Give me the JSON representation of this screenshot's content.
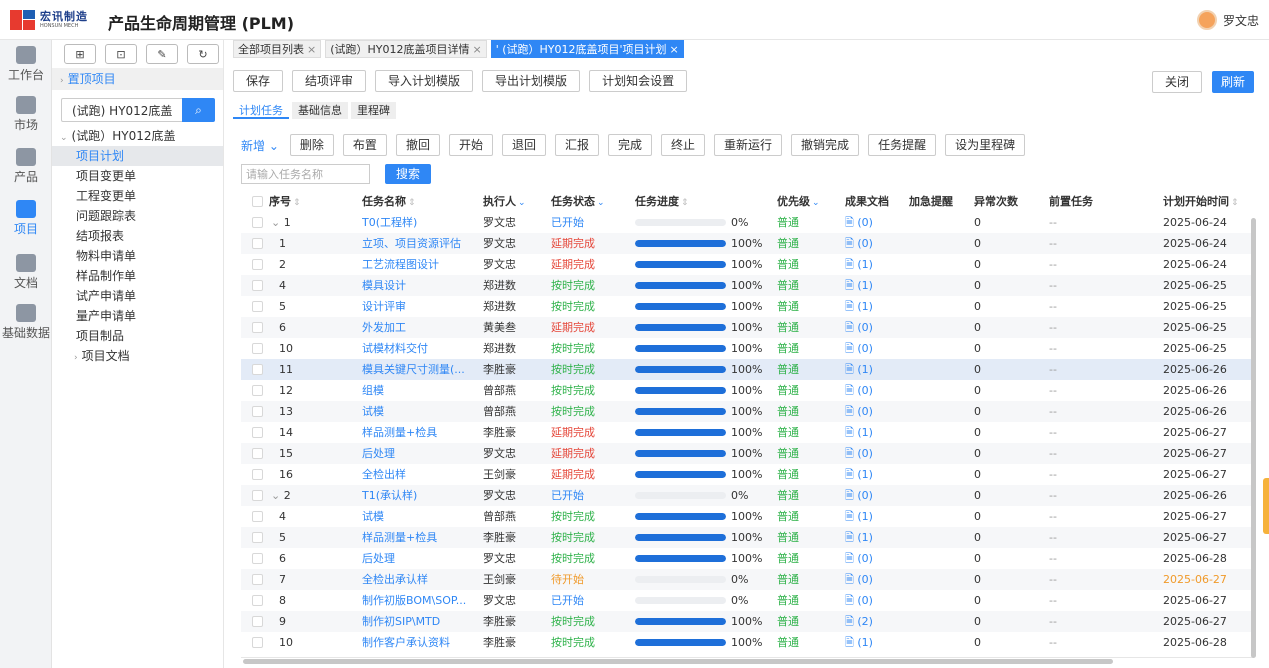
{
  "brand": {
    "name_cn": "宏讯制造",
    "name_en": "HONSUN MECH"
  },
  "app_title": "产品生命周期管理 (PLM)",
  "user": {
    "name": "罗文忠"
  },
  "rail": [
    {
      "label": "工作台",
      "active": false
    },
    {
      "label": "市场",
      "active": false
    },
    {
      "label": "产品",
      "active": false
    },
    {
      "label": "项目",
      "active": true
    },
    {
      "label": "文档",
      "active": false
    },
    {
      "label": "基础数据",
      "active": false
    }
  ],
  "tree": {
    "tools": [
      "⊞",
      "⊡",
      "✎",
      "↻"
    ],
    "pinned": "置顶项目",
    "search_value": "(试跑) HY012底盖",
    "search_icon": "search-icon",
    "root": "(试跑）HY012底盖",
    "children": [
      "项目计划",
      "项目变更单",
      "工程变更单",
      "问题跟踪表",
      "结项报表",
      "物料申请单",
      "样品制作单",
      "试产申请单",
      "量产申请单",
      "项目制品"
    ],
    "selected_index": 0,
    "folder": "项目文档"
  },
  "tabs": [
    {
      "label": "全部项目列表",
      "active": false
    },
    {
      "label": "(试跑）HY012底盖项目详情",
      "active": false
    },
    {
      "label": "' (试跑）HY012底盖项目'项目计划",
      "active": true
    }
  ],
  "toolbar1": [
    "保存",
    "结项评审",
    "导入计划模版",
    "导出计划模版",
    "计划知会设置"
  ],
  "toolbar1_right": {
    "close": "关闭",
    "refresh": "刷新"
  },
  "subtabs": [
    {
      "label": "计划任务",
      "active": true
    },
    {
      "label": "基础信息",
      "active": false
    },
    {
      "label": "里程碑",
      "active": false
    }
  ],
  "toolbar2": {
    "new": "新增",
    "buttons": [
      "删除",
      "布置",
      "撤回",
      "开始",
      "退回",
      "汇报",
      "完成",
      "终止",
      "重新运行",
      "撤销完成",
      "任务提醒",
      "设为里程碑"
    ]
  },
  "filter": {
    "placeholder": "请输入任务名称",
    "search": "搜索"
  },
  "columns": [
    "序号",
    "任务名称",
    "执行人",
    "任务状态",
    "任务进度",
    "优先级",
    "成果文档",
    "加急提醒",
    "异常次数",
    "前置任务",
    "计划开始时间"
  ],
  "rows": [
    {
      "no": "1",
      "group": true,
      "name": "T0(工程样)",
      "owner": "罗文忠",
      "status": "已开始",
      "status_type": "blue",
      "progress": 0,
      "prio": "普通",
      "docs": "(0)",
      "abn": "0",
      "pre": "--",
      "date": "2025-06-24"
    },
    {
      "no": "1",
      "name": "立项、项目资源评估",
      "owner": "罗文忠",
      "status": "延期完成",
      "status_type": "red",
      "progress": 100,
      "prio": "普通",
      "docs": "(0)",
      "abn": "0",
      "pre": "--",
      "date": "2025-06-24"
    },
    {
      "no": "2",
      "name": "工艺流程图设计",
      "owner": "罗文忠",
      "status": "延期完成",
      "status_type": "red",
      "progress": 100,
      "prio": "普通",
      "docs": "(1)",
      "abn": "0",
      "pre": "--",
      "date": "2025-06-24"
    },
    {
      "no": "4",
      "name": "模具设计",
      "owner": "郑进数",
      "status": "按时完成",
      "status_type": "green",
      "progress": 100,
      "prio": "普通",
      "docs": "(1)",
      "abn": "0",
      "pre": "--",
      "date": "2025-06-25"
    },
    {
      "no": "5",
      "name": "设计评审",
      "owner": "郑进数",
      "status": "按时完成",
      "status_type": "green",
      "progress": 100,
      "prio": "普通",
      "docs": "(1)",
      "abn": "0",
      "pre": "--",
      "date": "2025-06-25"
    },
    {
      "no": "6",
      "name": "外发加工",
      "owner": "黄美叁",
      "status": "延期完成",
      "status_type": "red",
      "progress": 100,
      "prio": "普通",
      "docs": "(0)",
      "abn": "0",
      "pre": "--",
      "date": "2025-06-25"
    },
    {
      "no": "10",
      "name": "试模材料交付",
      "owner": "郑进数",
      "status": "按时完成",
      "status_type": "green",
      "progress": 100,
      "prio": "普通",
      "docs": "(0)",
      "abn": "0",
      "pre": "--",
      "date": "2025-06-25"
    },
    {
      "no": "11",
      "name": "模具关键尺寸测量(...",
      "owner": "李胜豪",
      "status": "按时完成",
      "status_type": "green",
      "progress": 100,
      "prio": "普通",
      "docs": "(1)",
      "abn": "0",
      "pre": "--",
      "date": "2025-06-26",
      "highlight": true
    },
    {
      "no": "12",
      "name": "组模",
      "owner": "曾部燕",
      "status": "按时完成",
      "status_type": "green",
      "progress": 100,
      "prio": "普通",
      "docs": "(0)",
      "abn": "0",
      "pre": "--",
      "date": "2025-06-26"
    },
    {
      "no": "13",
      "name": "试模",
      "owner": "曾部燕",
      "status": "按时完成",
      "status_type": "green",
      "progress": 100,
      "prio": "普通",
      "docs": "(0)",
      "abn": "0",
      "pre": "--",
      "date": "2025-06-26"
    },
    {
      "no": "14",
      "name": "样品测量+检具",
      "owner": "李胜豪",
      "status": "延期完成",
      "status_type": "red",
      "progress": 100,
      "prio": "普通",
      "docs": "(1)",
      "abn": "0",
      "pre": "--",
      "date": "2025-06-27"
    },
    {
      "no": "15",
      "name": "后处理",
      "owner": "罗文忠",
      "status": "延期完成",
      "status_type": "red",
      "progress": 100,
      "prio": "普通",
      "docs": "(0)",
      "abn": "0",
      "pre": "--",
      "date": "2025-06-27"
    },
    {
      "no": "16",
      "name": "全检出样",
      "owner": "王剑豪",
      "status": "延期完成",
      "status_type": "red",
      "progress": 100,
      "prio": "普通",
      "docs": "(1)",
      "abn": "0",
      "pre": "--",
      "date": "2025-06-27"
    },
    {
      "no": "2",
      "group": true,
      "name": "T1(承认样)",
      "owner": "罗文忠",
      "status": "已开始",
      "status_type": "blue",
      "progress": 0,
      "prio": "普通",
      "docs": "(0)",
      "abn": "0",
      "pre": "--",
      "date": "2025-06-26"
    },
    {
      "no": "4",
      "name": "试模",
      "owner": "曾部燕",
      "status": "按时完成",
      "status_type": "green",
      "progress": 100,
      "prio": "普通",
      "docs": "(1)",
      "abn": "0",
      "pre": "--",
      "date": "2025-06-27"
    },
    {
      "no": "5",
      "name": "样品测量+检具",
      "owner": "李胜豪",
      "status": "按时完成",
      "status_type": "green",
      "progress": 100,
      "prio": "普通",
      "docs": "(1)",
      "abn": "0",
      "pre": "--",
      "date": "2025-06-27"
    },
    {
      "no": "6",
      "name": "后处理",
      "owner": "罗文忠",
      "status": "按时完成",
      "status_type": "green",
      "progress": 100,
      "prio": "普通",
      "docs": "(0)",
      "abn": "0",
      "pre": "--",
      "date": "2025-06-28"
    },
    {
      "no": "7",
      "name": "全检出承认样",
      "owner": "王剑豪",
      "status": "待开始",
      "status_type": "orange",
      "progress": 0,
      "prio": "普通",
      "docs": "(0)",
      "abn": "0",
      "pre": "--",
      "date": "2025-06-27",
      "date_warn": true
    },
    {
      "no": "8",
      "name": "制作初版BOM\\SOP...",
      "owner": "罗文忠",
      "status": "已开始",
      "status_type": "blue",
      "progress": 0,
      "prio": "普通",
      "docs": "(0)",
      "abn": "0",
      "pre": "--",
      "date": "2025-06-27"
    },
    {
      "no": "9",
      "name": "制作初SIP\\MTD",
      "owner": "李胜豪",
      "status": "按时完成",
      "status_type": "green",
      "progress": 100,
      "prio": "普通",
      "docs": "(2)",
      "abn": "0",
      "pre": "--",
      "date": "2025-06-27"
    },
    {
      "no": "10",
      "name": "制作客户承认资料",
      "owner": "李胜豪",
      "status": "按时完成",
      "status_type": "green",
      "progress": 100,
      "prio": "普通",
      "docs": "(1)",
      "abn": "0",
      "pre": "--",
      "date": "2025-06-28"
    }
  ],
  "colors": {
    "accent": "#2f87f5",
    "green": "#2fb24a",
    "red": "#e5473a",
    "orange": "#f09a2a",
    "bar": "#1e6fd9"
  }
}
